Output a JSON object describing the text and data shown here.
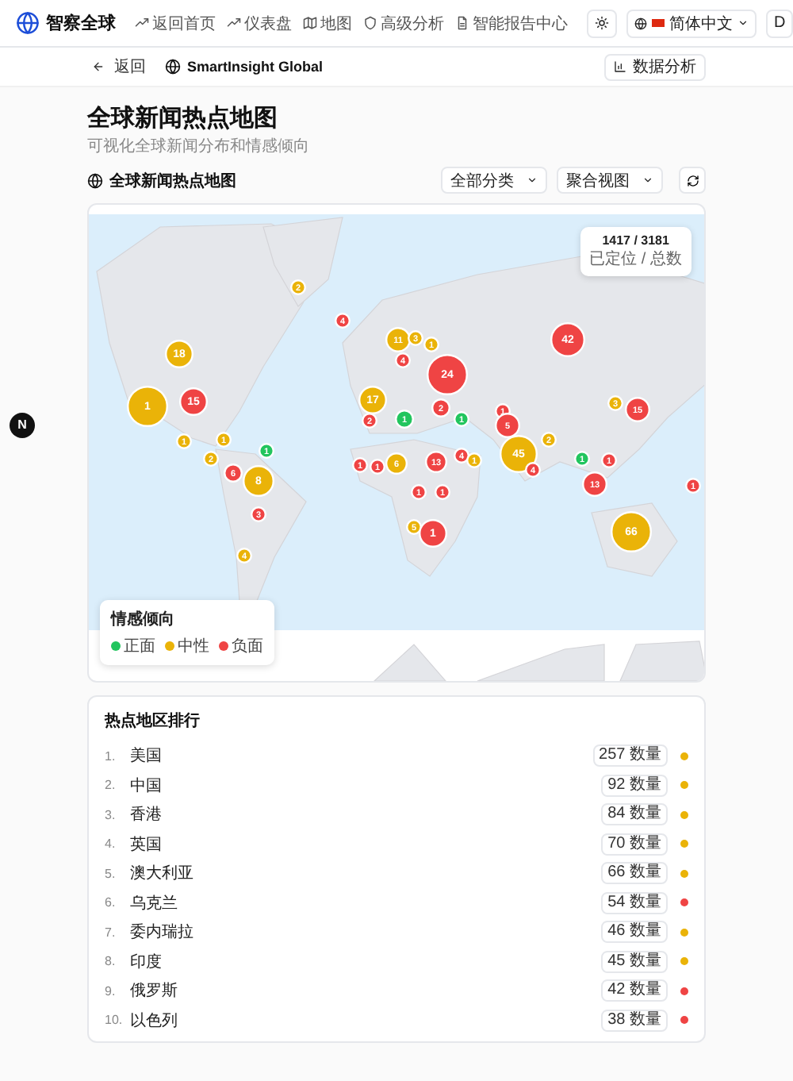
{
  "header": {
    "logo": "智察全球",
    "nav": [
      {
        "label": "返回首页",
        "kind": "trend"
      },
      {
        "label": "仪表盘",
        "kind": "trend"
      },
      {
        "label": "地图",
        "kind": "map"
      },
      {
        "label": "高级分析",
        "kind": "shield"
      },
      {
        "label": "智能报告中心",
        "kind": "doc"
      }
    ],
    "language": "简体中文",
    "user": "D"
  },
  "subbar": {
    "back": "返回",
    "brand": "SmartInsight Global",
    "analysis": "数据分析"
  },
  "side_button": "N",
  "page": {
    "title": "全球新闻热点地图",
    "subtitle": "可视化全球新闻分布和情感倾向"
  },
  "section": {
    "title": "全球新闻热点地图",
    "filters": [
      {
        "value": "全部分类"
      },
      {
        "value": "聚合视图"
      }
    ]
  },
  "map": {
    "stats": {
      "value": "1417 / 3181",
      "caption": "已定位 / 总数"
    },
    "legend": {
      "title": "情感倾向",
      "items": [
        {
          "label": "正面",
          "color": "#22c55e"
        },
        {
          "label": "中性",
          "color": "#eab308"
        },
        {
          "label": "负面",
          "color": "#ef4444"
        }
      ]
    },
    "clusters": [
      {
        "label": "2",
        "color": "#eab308"
      },
      {
        "label": "4",
        "color": "#ef4444"
      },
      {
        "label": "11",
        "color": "#eab308"
      },
      {
        "label": "3",
        "color": "#eab308"
      },
      {
        "label": "1",
        "color": "#eab308"
      },
      {
        "label": "42",
        "color": "#ef4444"
      },
      {
        "label": "18",
        "color": "#eab308"
      },
      {
        "label": "4",
        "color": "#ef4444"
      },
      {
        "label": "24",
        "color": "#ef4444"
      },
      {
        "label": "1",
        "color": "#eab308"
      },
      {
        "label": "15",
        "color": "#ef4444"
      },
      {
        "label": "17",
        "color": "#eab308"
      },
      {
        "label": "2",
        "color": "#ef4444"
      },
      {
        "label": "1",
        "color": "#ef4444"
      },
      {
        "label": "3",
        "color": "#eab308"
      },
      {
        "label": "15",
        "color": "#ef4444"
      },
      {
        "label": "2",
        "color": "#ef4444"
      },
      {
        "label": "1",
        "color": "#22c55e"
      },
      {
        "label": "1",
        "color": "#22c55e"
      },
      {
        "label": "5",
        "color": "#ef4444"
      },
      {
        "label": "1",
        "color": "#eab308"
      },
      {
        "label": "1",
        "color": "#eab308"
      },
      {
        "label": "2",
        "color": "#eab308"
      },
      {
        "label": "2",
        "color": "#eab308"
      },
      {
        "label": "1",
        "color": "#22c55e"
      },
      {
        "label": "1",
        "color": "#ef4444"
      },
      {
        "label": "1",
        "color": "#ef4444"
      },
      {
        "label": "6",
        "color": "#eab308"
      },
      {
        "label": "13",
        "color": "#ef4444"
      },
      {
        "label": "4",
        "color": "#ef4444"
      },
      {
        "label": "1",
        "color": "#eab308"
      },
      {
        "label": "45",
        "color": "#eab308"
      },
      {
        "label": "4",
        "color": "#ef4444"
      },
      {
        "label": "1",
        "color": "#22c55e"
      },
      {
        "label": "1",
        "color": "#ef4444"
      },
      {
        "label": "6",
        "color": "#ef4444"
      },
      {
        "label": "8",
        "color": "#eab308"
      },
      {
        "label": "13",
        "color": "#ef4444"
      },
      {
        "label": "1",
        "color": "#ef4444"
      },
      {
        "label": "1",
        "color": "#ef4444"
      },
      {
        "label": "1",
        "color": "#ef4444"
      },
      {
        "label": "3",
        "color": "#ef4444"
      },
      {
        "label": "5",
        "color": "#eab308"
      },
      {
        "label": "1",
        "color": "#ef4444"
      },
      {
        "label": "66",
        "color": "#eab308"
      },
      {
        "label": "4",
        "color": "#eab308"
      }
    ]
  },
  "ranking": {
    "title": "热点地区排行",
    "items": [
      {
        "rank": "1.",
        "name": "美国",
        "count": "257 数量",
        "color": "#eab308"
      },
      {
        "rank": "2.",
        "name": "中国",
        "count": "92 数量",
        "color": "#eab308"
      },
      {
        "rank": "3.",
        "name": "香港",
        "count": "84 数量",
        "color": "#eab308"
      },
      {
        "rank": "4.",
        "name": "英国",
        "count": "70 数量",
        "color": "#eab308"
      },
      {
        "rank": "5.",
        "name": "澳大利亚",
        "count": "66 数量",
        "color": "#eab308"
      },
      {
        "rank": "6.",
        "name": "乌克兰",
        "count": "54 数量",
        "color": "#ef4444"
      },
      {
        "rank": "7.",
        "name": "委内瑞拉",
        "count": "46 数量",
        "color": "#eab308"
      },
      {
        "rank": "8.",
        "name": "印度",
        "count": "45 数量",
        "color": "#eab308"
      },
      {
        "rank": "9.",
        "name": "俄罗斯",
        "count": "42 数量",
        "color": "#ef4444"
      },
      {
        "rank": "10.",
        "name": "以色列",
        "count": "38 数量",
        "color": "#ef4444"
      }
    ]
  }
}
